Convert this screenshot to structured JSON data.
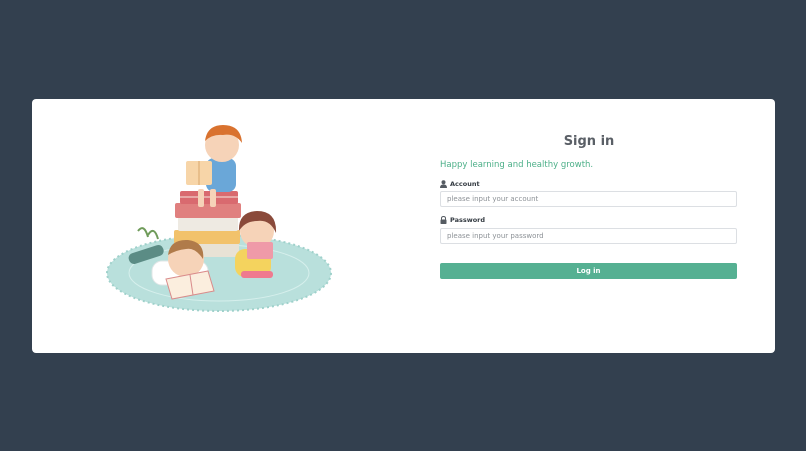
{
  "login": {
    "title": "Sign in",
    "tagline": "Happy learning and healthy growth.",
    "account": {
      "label": "Account",
      "icon": "user-icon",
      "placeholder": "please input your account",
      "value": ""
    },
    "password": {
      "label": "Password",
      "icon": "lock-icon",
      "placeholder": "please input your password",
      "value": ""
    },
    "submit_label": "Log in"
  },
  "colors": {
    "background": "#33404f",
    "card": "#ffffff",
    "accent": "#55b092",
    "tagline": "#4caf88",
    "title": "#5a5f66"
  }
}
